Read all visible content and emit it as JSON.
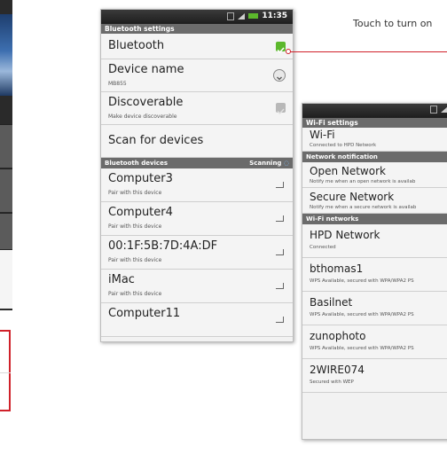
{
  "callout": {
    "text": "Touch to turn on"
  },
  "bt": {
    "status_time": "11:35",
    "title": "Bluetooth settings",
    "bluetooth_label": "Bluetooth",
    "device_name_label": "Device name",
    "device_name_value": "MB855",
    "discoverable_label": "Discoverable",
    "discoverable_sub": "Make device discoverable",
    "scan_label": "Scan for devices",
    "devices_header": "Bluetooth devices",
    "scanning_label": "Scanning",
    "devices": [
      {
        "name": "Computer3",
        "sub": "Pair with this device"
      },
      {
        "name": "Computer4",
        "sub": "Pair with this device"
      },
      {
        "name": "00:1F:5B:7D:4A:DF",
        "sub": "Pair with this device"
      },
      {
        "name": "iMac",
        "sub": "Pair with this device"
      },
      {
        "name": "Computer11",
        "sub": ""
      }
    ]
  },
  "wifi": {
    "title": "Wi-Fi settings",
    "wifi_label": "Wi-Fi",
    "wifi_sub": "Connected to HPD Network",
    "notif_header": "Network notification",
    "open_label": "Open Network",
    "open_sub": "Notify me when an open network is availab",
    "secure_label": "Secure Network",
    "secure_sub": "Notify me when a secure network is availab",
    "networks_header": "Wi-Fi networks",
    "networks": [
      {
        "name": "HPD Network",
        "sub": "Connected"
      },
      {
        "name": "bthomas1",
        "sub": "WPS Available, secured with WPA/WPA2 PS"
      },
      {
        "name": "Basilnet",
        "sub": "WPS Available, secured with WPA/WPA2 PS"
      },
      {
        "name": "zunophoto",
        "sub": "WPS Available, secured with WPA/WPA2 PS"
      },
      {
        "name": "2WIRE074",
        "sub": "Secured with WEP"
      }
    ]
  },
  "colors": {
    "accent_green": "#5cb82c",
    "callout_red": "#d0212a"
  },
  "icons": [
    "wifi-signal-icon",
    "battery-icon",
    "checkbox-checked-icon",
    "device-name-arrow-icon",
    "scanning-spinner-icon",
    "lock-icon"
  ]
}
